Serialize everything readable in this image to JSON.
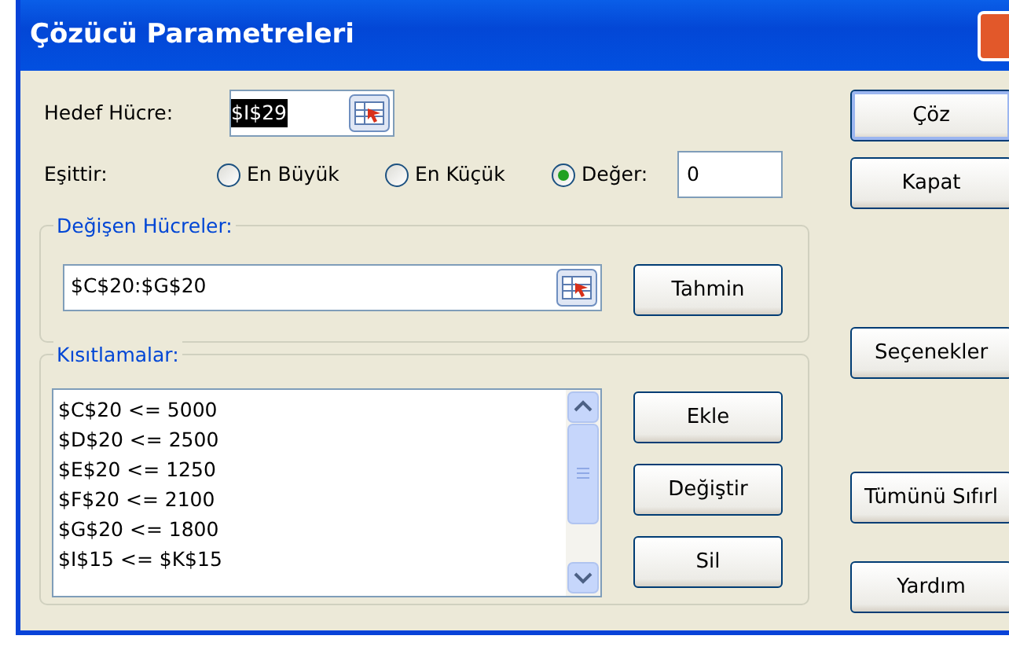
{
  "window": {
    "title": "Çözücü Parametreleri"
  },
  "target": {
    "label": "Hedef Hücre:",
    "value": "$I$29",
    "selected": true
  },
  "equals": {
    "label": "Eşittir:",
    "options": [
      {
        "label": "En Büyük",
        "selected": false
      },
      {
        "label": "En Küçük",
        "selected": false
      },
      {
        "label": "Değer:",
        "selected": true
      }
    ],
    "value": "0"
  },
  "changing_cells": {
    "title": "Değişen Hücreler:",
    "value": "$C$20:$G$20",
    "button": "Tahmin"
  },
  "constraints": {
    "title": "Kısıtlamalar:",
    "items": [
      "$C$20 <= 5000",
      "$D$20 <= 2500",
      "$E$20 <= 1250",
      "$F$20 <= 2100",
      "$G$20 <= 1800",
      "$I$15 <= $K$15"
    ],
    "buttons": [
      "Ekle",
      "Değiştir",
      "Sil"
    ]
  },
  "side_buttons": [
    {
      "label": "Çöz",
      "default": true
    },
    {
      "label": "Kapat",
      "default": false
    },
    {
      "label": "Seçenekler",
      "default": false
    },
    {
      "label": "Tümünü Sıfırl",
      "default": false
    },
    {
      "label": "Yardım",
      "default": false
    }
  ]
}
